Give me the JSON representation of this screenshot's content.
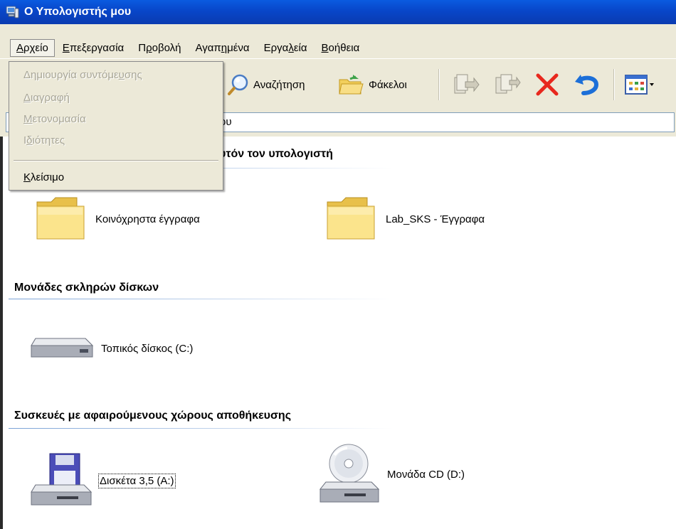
{
  "window": {
    "title": "Ο Υπολογιστής μου"
  },
  "menubar": {
    "items": [
      {
        "pre": "",
        "u": "Α",
        "post": "ρχείο"
      },
      {
        "pre": "",
        "u": "Ε",
        "post": "πεξεργασία"
      },
      {
        "pre": "Π",
        "u": "ρ",
        "post": "οβολή"
      },
      {
        "pre": "Αγαπ",
        "u": "η",
        "post": "μένα"
      },
      {
        "pre": "Εργα",
        "u": "λ",
        "post": "εία"
      },
      {
        "pre": "",
        "u": "Β",
        "post": "οήθεια"
      }
    ]
  },
  "file_menu": {
    "items": [
      {
        "pre": "Δημιουργία συντόμε",
        "u": "υ",
        "post": "σης",
        "enabled": false
      },
      {
        "pre": "",
        "u": "Δ",
        "post": "ιαγραφή",
        "enabled": false
      },
      {
        "pre": "",
        "u": "Μ",
        "post": "ετονομασία",
        "enabled": false
      },
      {
        "pre": "Ι",
        "u": "δ",
        "post": "ιότητες",
        "enabled": false
      },
      {
        "pre": "",
        "u": "Κ",
        "post": "λείσιμο",
        "enabled": true
      }
    ]
  },
  "toolbar": {
    "search_label": "Αναζήτηση",
    "folders_label": "Φάκελοι"
  },
  "address": {
    "value": "ου"
  },
  "groups": {
    "stored_title_partial": "υτόν τον υπολογιστή",
    "hard_disks_title": "Μονάδες σκληρών δίσκων",
    "removable_title": "Συσκευές με αφαιρούμενους χώρους αποθήκευσης"
  },
  "items": {
    "shared_docs": "Κοινόχρηστα έγγραφα",
    "lab_docs": "Lab_SKS - Έγγραφα",
    "local_disk": "Τοπικός δίσκος (C:)",
    "floppy": "Δισκέτα 3,5 (A:)",
    "cd_drive": "Μονάδα CD (D:)"
  },
  "colors": {
    "titlebar": "#0a4fd4",
    "chrome": "#ece9d8",
    "delete_x": "#e8281d",
    "undo_arrow": "#1c6fd8"
  },
  "icons": [
    "computer-icon",
    "search-icon",
    "folders-icon",
    "move-to-icon",
    "copy-to-icon",
    "delete-icon",
    "undo-icon",
    "views-icon",
    "folder-icon",
    "hard-disk-icon",
    "floppy-drive-icon",
    "cd-drive-icon"
  ]
}
